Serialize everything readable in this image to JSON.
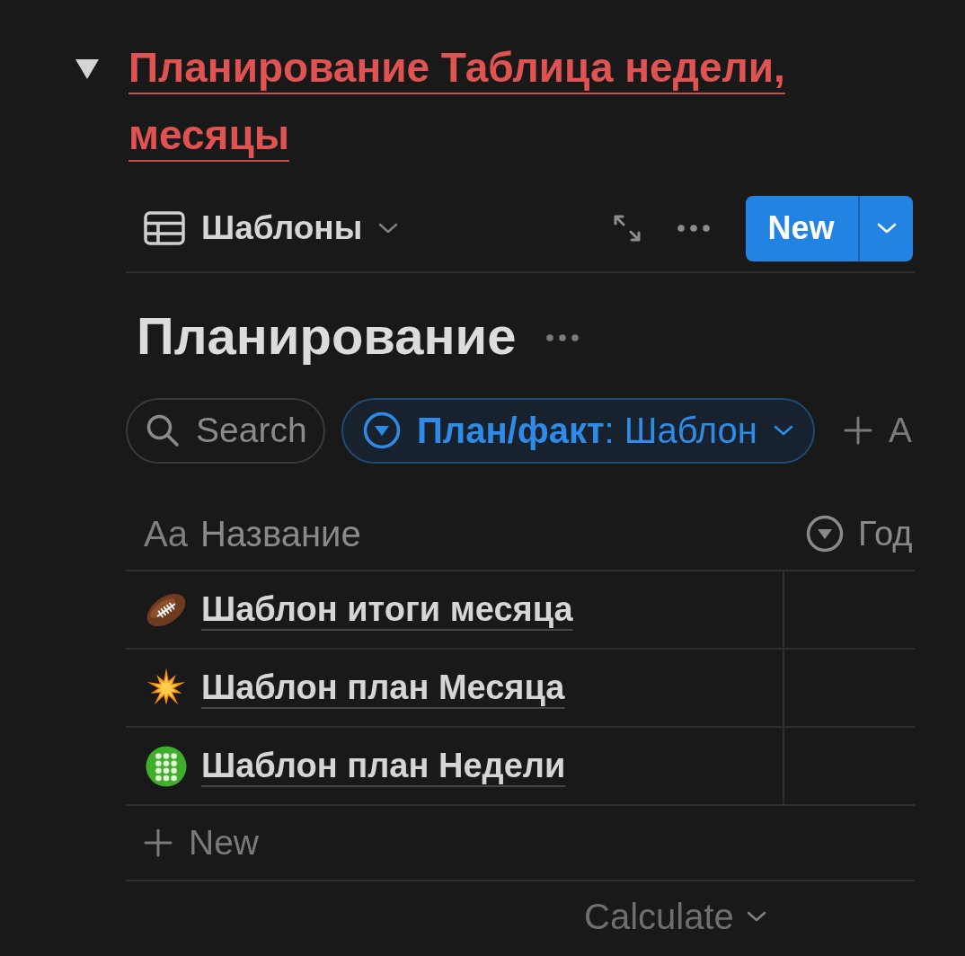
{
  "block": {
    "expanded": true,
    "title": "Планирование Таблица недели, месяцы"
  },
  "view_bar": {
    "view": {
      "label": "Шаблоны"
    },
    "new_button": {
      "label": "New"
    }
  },
  "database": {
    "title": "Планирование",
    "search": {
      "placeholder": "Search"
    },
    "filters": [
      {
        "label": "**План/факт**: Шаблон",
        "active": true
      }
    ],
    "add_filter": {
      "label": "A"
    },
    "table": {
      "columns": [
        {
          "kind": "title",
          "type_label": "Aa",
          "label": "Название"
        },
        {
          "kind": "select",
          "label": "Год"
        }
      ],
      "rows": [
        {
          "title": "Шаблон итоги месяца"
        },
        {
          "title": "Шаблон план Месяца"
        },
        {
          "title": "Шаблон план Недели"
        }
      ]
    },
    "new_row": {
      "label": "New"
    },
    "footer": {
      "calculate": "Calculate"
    }
  }
}
